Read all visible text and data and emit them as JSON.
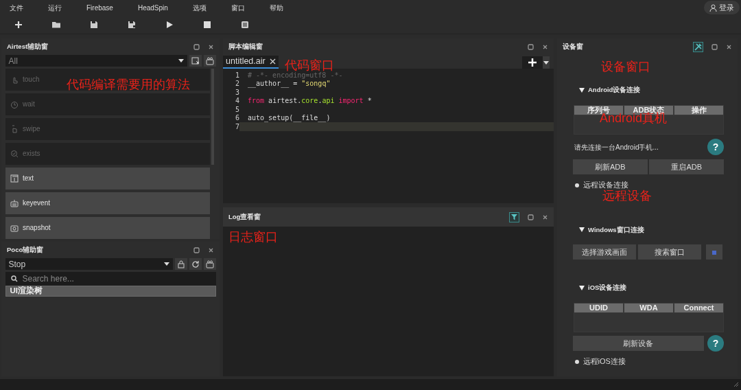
{
  "menu": [
    {
      "label": "文件"
    },
    {
      "label": "运行"
    },
    {
      "label": "Firebase"
    },
    {
      "label": "HeadSpin"
    },
    {
      "label": "选项"
    },
    {
      "label": "窗口"
    },
    {
      "label": "帮助"
    }
  ],
  "login": "登录",
  "airtest": {
    "title": "Airtest辅助窗",
    "filter": "All",
    "annotation": "代码编译需要用的算法",
    "actions": [
      {
        "label": "touch",
        "disabled": true
      },
      {
        "label": "wait",
        "disabled": true
      },
      {
        "label": "swipe",
        "disabled": true
      },
      {
        "label": "exists",
        "disabled": true
      },
      {
        "label": "text",
        "disabled": false
      },
      {
        "label": "keyevent",
        "disabled": false
      },
      {
        "label": "snapshot",
        "disabled": false
      }
    ]
  },
  "poco": {
    "title": "Poco辅助窗",
    "mode": "Stop",
    "search": {
      "placeholder": "Search here..."
    },
    "tree": [
      {
        "label": "UI渲染树",
        "selected": true
      }
    ]
  },
  "editor": {
    "title": "脚本编辑窗",
    "annotation": "代码窗口",
    "tabs": [
      {
        "label": "untitled.air",
        "selected": true
      }
    ],
    "lines": [
      {
        "number": "1",
        "current": false,
        "tokens": [
          {
            "kind": "comment",
            "text": "# -*- encoding=utf8 -*-"
          }
        ]
      },
      {
        "number": "2",
        "current": false,
        "tokens": [
          {
            "kind": "plain",
            "text": "__author__ = "
          },
          {
            "kind": "string",
            "text": "\"songq\""
          }
        ]
      },
      {
        "number": "3",
        "current": false
      },
      {
        "number": "4",
        "current": false,
        "tokens": [
          {
            "kind": "keyword",
            "text": "from"
          },
          {
            "kind": "plain",
            "text": " airtest."
          },
          {
            "kind": "module",
            "text": "core"
          },
          {
            "kind": "plain",
            "text": "."
          },
          {
            "kind": "module",
            "text": "api"
          },
          {
            "kind": "keyword",
            "text": " import"
          },
          {
            "kind": "plain",
            "text": " *"
          }
        ]
      },
      {
        "number": "5",
        "current": false
      },
      {
        "number": "6",
        "current": false,
        "tokens": [
          {
            "kind": "plain",
            "text": "auto_setup(__file__)"
          }
        ]
      },
      {
        "number": "7",
        "current": true
      }
    ]
  },
  "log": {
    "title": "Log查看窗",
    "annotation": "日志窗口"
  },
  "device": {
    "title": "设备窗",
    "annotation": "设备窗口",
    "remote_annotation": "远程设备",
    "android": {
      "heading": "Android设备连接",
      "expanded": true,
      "columns": [
        "序列号",
        "ADB状态",
        "操作"
      ],
      "annotation": "Android真机",
      "hint": "请先连接一台Android手机...",
      "help": "?",
      "buttons": [
        "刷新ADB",
        "重启ADB"
      ],
      "remote": {
        "label": "远程设备连接",
        "checked": false
      }
    },
    "windows": {
      "heading": "Windows窗口连接",
      "expanded": true,
      "buttons": [
        "选择游戏画面",
        "搜索窗口"
      ]
    },
    "ios": {
      "heading": "iOS设备连接",
      "expanded": true,
      "columns": [
        "UDID",
        "WDA",
        "Connect"
      ],
      "button": "刷新设备",
      "help": "?",
      "remote": {
        "label": "远程iOS连接",
        "checked": false
      }
    }
  }
}
